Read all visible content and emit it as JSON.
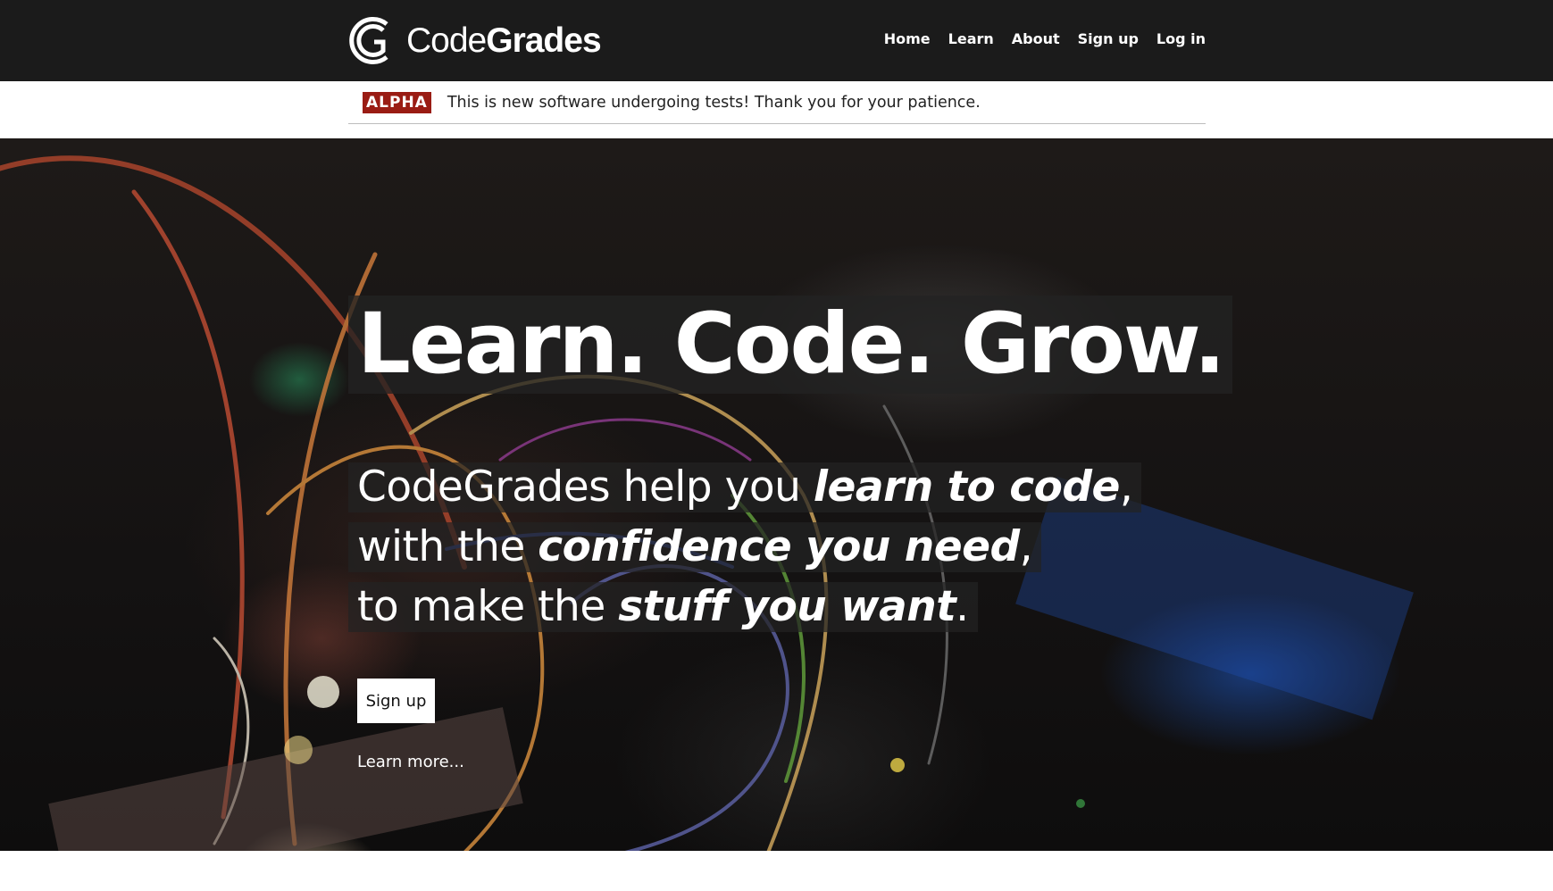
{
  "brand": {
    "name_light": "Code",
    "name_bold": "Grades"
  },
  "nav": {
    "items": [
      {
        "label": "Home"
      },
      {
        "label": "Learn"
      },
      {
        "label": "About"
      },
      {
        "label": "Sign up"
      },
      {
        "label": "Log in"
      }
    ]
  },
  "notice": {
    "badge": "ALPHA",
    "text": "This is new software undergoing tests! Thank you for your patience."
  },
  "hero": {
    "headline": "Learn. Code. Grow.",
    "tagline": [
      {
        "plain": "CodeGrades help you ",
        "emphasis": "learn to code",
        "end": ","
      },
      {
        "plain": "with the ",
        "emphasis": "confidence you need",
        "end": ","
      },
      {
        "plain": "to make the ",
        "emphasis": "stuff you want",
        "end": "."
      }
    ],
    "signup_label": "Sign up",
    "learn_more_label": "Learn more..."
  },
  "colors": {
    "topbar": "#1b1b1b",
    "alpha_badge": "#9a1c14",
    "hero_text": "#ffffff"
  }
}
